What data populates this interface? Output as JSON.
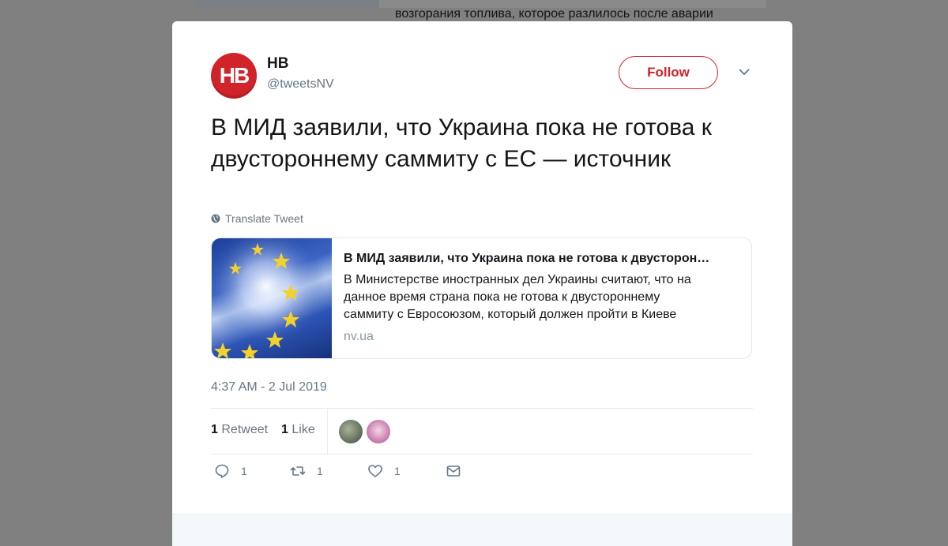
{
  "background": {
    "snippet_text": "возгорания топлива, которое разлилось после аварии"
  },
  "tweet": {
    "author_name": "НВ",
    "author_handle": "@tweetsNV",
    "avatar_text": "НВ",
    "follow_label": "Follow",
    "text": "В МИД заявили, что Украина пока не готова к двустороннему саммиту с ЕС — источник",
    "translate_label": "Translate Tweet",
    "card": {
      "title": "В МИД заявили, что Украина пока не готова к двусторон…",
      "description": "В Министерстве иностранных дел Украины считают, что на данное время страна пока не готова к двустороннему саммиту с Евросоюзом, который должен пройти в Киеве",
      "domain": "nv.ua"
    },
    "timestamp": "4:37 AM - 2 Jul 2019",
    "stats": {
      "retweets_count": "1",
      "retweets_label": "Retweet",
      "likes_count": "1",
      "likes_label": "Like"
    },
    "actions": {
      "reply_count": "1",
      "retweet_count": "1",
      "like_count": "1"
    }
  },
  "colors": {
    "brand": "#d0242a",
    "overlay": "#808080",
    "secondary_text": "#657786"
  }
}
